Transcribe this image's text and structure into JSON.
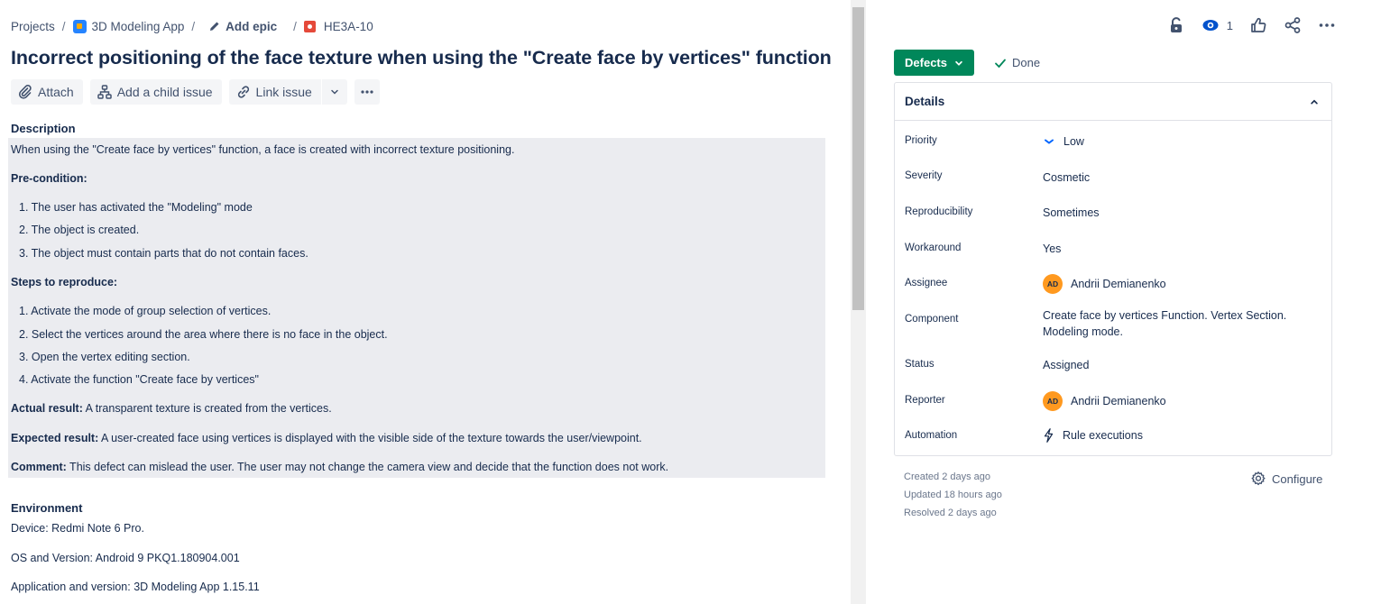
{
  "breadcrumb": {
    "projects": "Projects",
    "app": "3D Modeling App",
    "add_epic": "Add epic",
    "issue_key": "HE3A-10"
  },
  "issue": {
    "title": "Incorrect positioning of the face texture when using the \"Create face by vertices\" function"
  },
  "toolbar": {
    "attach": "Attach",
    "add_child": "Add a child issue",
    "link_issue": "Link issue"
  },
  "description": {
    "label": "Description",
    "intro": "When using the \"Create face by vertices\" function, a face is created with incorrect texture positioning.",
    "precondition_label": "Pre-condition:",
    "preconditions": [
      "1. The user has activated the \"Modeling\" mode",
      "2. The object is created.",
      "3. The object must contain parts that do not contain faces."
    ],
    "steps_label": "Steps to reproduce:",
    "steps": [
      "1. Activate the mode of group selection of vertices.",
      "2. Select the vertices around the area where there is no face in the object.",
      "3. Open the vertex editing section.",
      "4. Activate the function \"Create face by vertices\""
    ],
    "actual_label": "Actual result:",
    "actual_text": " A transparent texture is created from the vertices.",
    "expected_label": "Expected result:",
    "expected_text": "  A user-created face using vertices is displayed with the visible side of the texture towards the user/viewpoint.",
    "comment_label": "Comment:",
    "comment_text": " This defect can mislead the user. The user may not change the camera view and decide that the function does not work."
  },
  "environment": {
    "label": "Environment",
    "device": "Device: Redmi Note 6 Pro.",
    "os": "OS and Version: Android 9 PKQ1.180904.001",
    "app": "Application and version: 3D Modeling App 1.15.11"
  },
  "header_actions": {
    "watch_count": "1"
  },
  "status": {
    "button": "Defects",
    "done": "Done",
    "button_color": "#00875a"
  },
  "details": {
    "title": "Details",
    "fields": [
      {
        "label": "Priority",
        "value": "Low"
      },
      {
        "label": "Severity",
        "value": "Cosmetic"
      },
      {
        "label": "Reproducibility",
        "value": "Sometimes"
      },
      {
        "label": "Workaround",
        "value": "Yes"
      },
      {
        "label": "Assignee",
        "value": "Andrii Demianenko",
        "avatar": "AD"
      },
      {
        "label": "Component",
        "value": "Create face by vertices Function. Vertex Section. Modeling mode."
      },
      {
        "label": "Status",
        "value": "Assigned"
      },
      {
        "label": "Reporter",
        "value": "Andrii Demianenko",
        "avatar": "AD"
      },
      {
        "label": "Automation",
        "value": "Rule executions"
      }
    ]
  },
  "meta": {
    "created": "Created 2 days ago",
    "updated": "Updated 18 hours ago",
    "resolved": "Resolved 2 days ago",
    "configure": "Configure"
  }
}
